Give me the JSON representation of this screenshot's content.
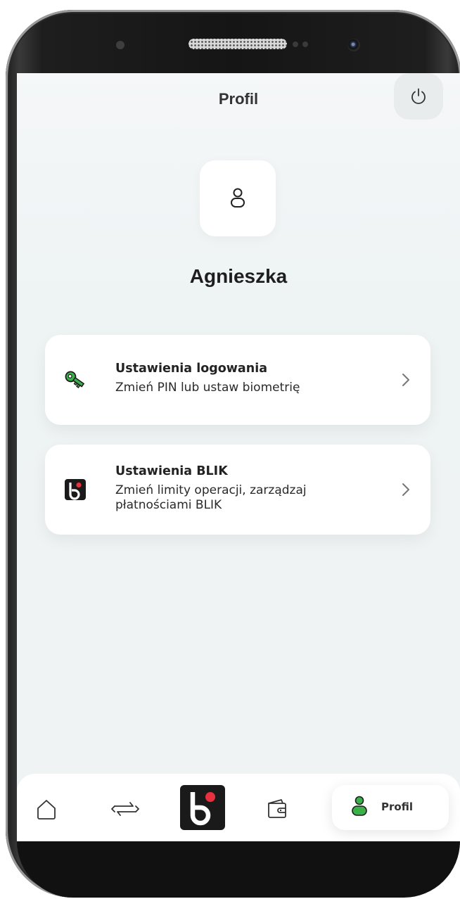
{
  "header": {
    "title": "Profil"
  },
  "profile": {
    "name": "Agnieszka"
  },
  "settings": [
    {
      "title": "Ustawienia logowania",
      "subtitle": "Zmień PIN lub ustaw biometrię",
      "icon": "key-icon"
    },
    {
      "title": "Ustawienia BLIK",
      "subtitle": "Zmień limity operacji, zarządzaj płatnościami BLIK",
      "icon": "blik-logo-icon"
    }
  ],
  "bottom_nav": {
    "items": [
      "home-icon",
      "transfer-icon",
      "blik-icon",
      "wallet-icon",
      "profile-icon"
    ],
    "active_label": "Profil"
  },
  "colors": {
    "accent_green": "#3bb14a",
    "blik_red": "#e8303f",
    "background": "#f1f4f5"
  }
}
